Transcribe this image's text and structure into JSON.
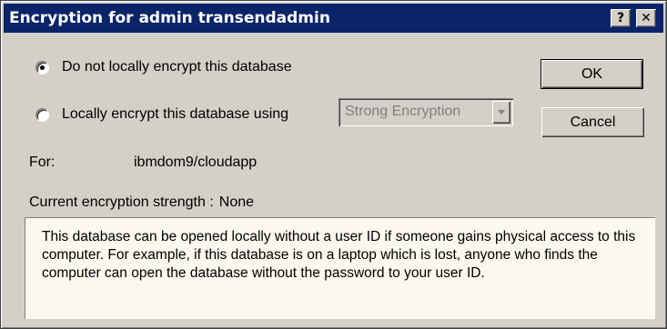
{
  "window": {
    "title": "Encryption for admin transendadmin",
    "help_label": "?",
    "close_label": "✕"
  },
  "options": {
    "no_encrypt_label": "Do not locally encrypt this database",
    "no_encrypt_selected": true,
    "encrypt_label": "Locally encrypt this database using",
    "encrypt_selected": false,
    "encryption_type": "Strong Encryption"
  },
  "buttons": {
    "ok": "OK",
    "cancel": "Cancel"
  },
  "details": {
    "for_label": "For:",
    "for_value": "ibmdom9/cloudapp",
    "strength_label": "Current encryption strength :",
    "strength_value": "None"
  },
  "info_text": "This database can be opened locally without a user ID if someone gains physical access to this computer. For example, if this database is on a laptop which is lost, anyone who finds the computer can open the database without the password to your user ID."
}
